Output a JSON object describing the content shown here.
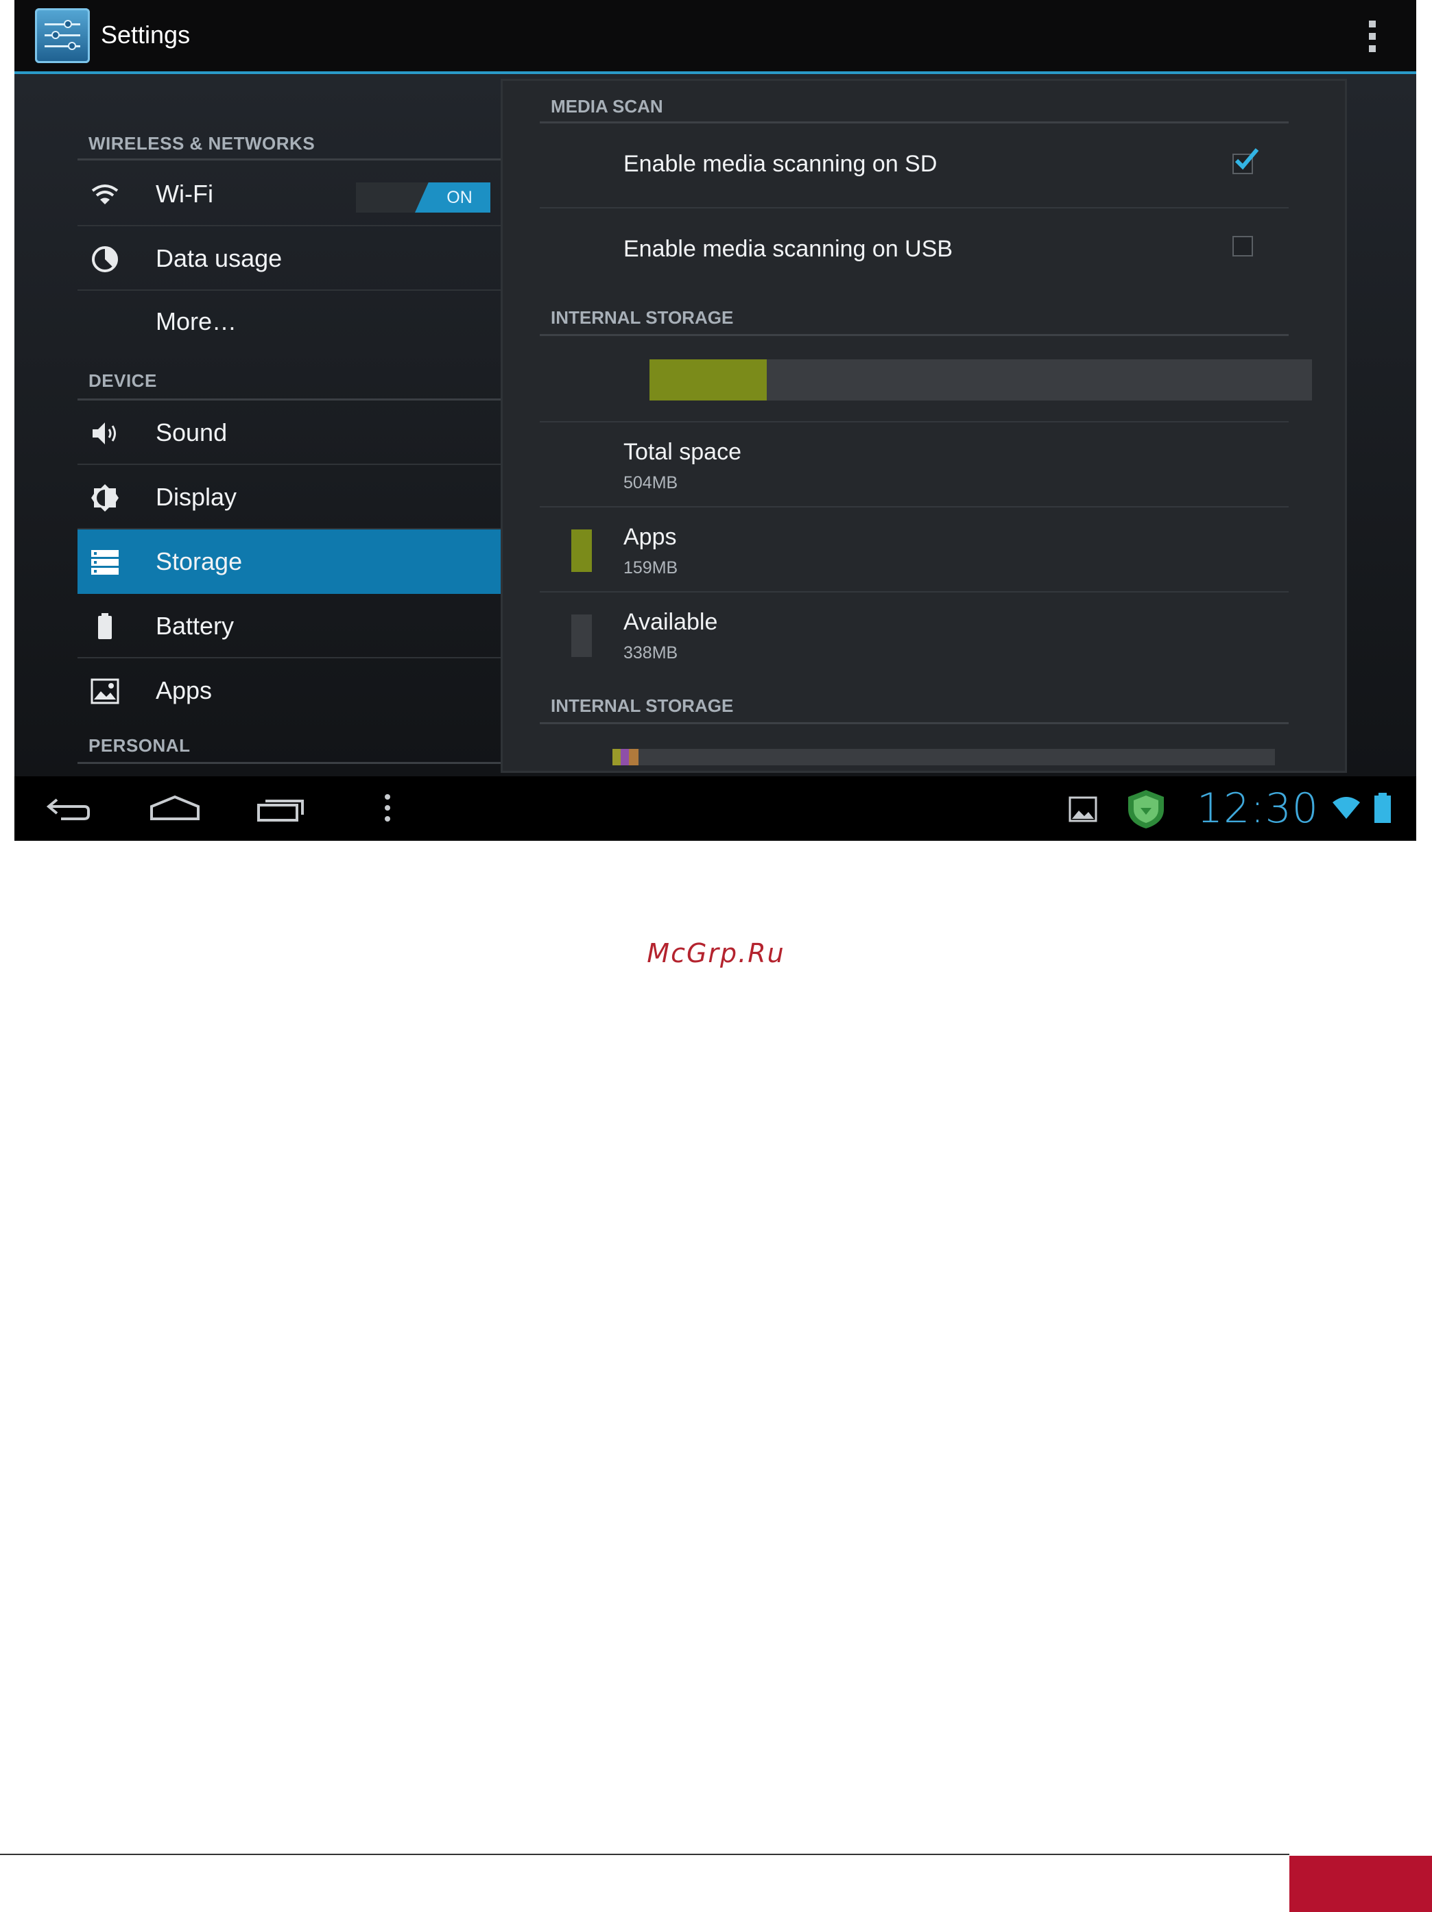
{
  "actionbar": {
    "title": "Settings",
    "icon": "settings-icon",
    "menu_icon": "overflow-menu-icon"
  },
  "sidebar": {
    "sections": [
      {
        "label": "WIRELESS & NETWORKS"
      },
      {
        "label": "DEVICE"
      },
      {
        "label": "PERSONAL"
      }
    ],
    "items": [
      {
        "label": "Wi-Fi",
        "icon": "wifi-icon",
        "toggle": "ON"
      },
      {
        "label": "Data usage",
        "icon": "data-usage-icon"
      },
      {
        "label": "More…",
        "icon": ""
      },
      {
        "label": "Sound",
        "icon": "speaker-icon"
      },
      {
        "label": "Display",
        "icon": "brightness-icon"
      },
      {
        "label": "Storage",
        "icon": "storage-icon",
        "selected": true
      },
      {
        "label": "Battery",
        "icon": "battery-icon"
      },
      {
        "label": "Apps",
        "icon": "apps-icon"
      }
    ]
  },
  "storage": {
    "media_scan": {
      "header": "MEDIA SCAN",
      "sd_label": "Enable media scanning on SD",
      "sd_checked": true,
      "usb_label": "Enable media scanning on USB",
      "usb_checked": false
    },
    "internal": {
      "header": "INTERNAL STORAGE",
      "used_fraction": 0.177,
      "total_label": "Total space",
      "total_value": "504MB",
      "apps_label": "Apps",
      "apps_value": "159MB",
      "available_label": "Available",
      "available_value": "338MB",
      "apps_color": "#7b8b1a",
      "available_color": "#3a3d41"
    },
    "internal2": {
      "header": "INTERNAL STORAGE"
    }
  },
  "statusbar": {
    "clock": "12:30",
    "icons": [
      "gallery-notification-icon",
      "shield-app-icon",
      "wifi-signal-icon",
      "battery-status-icon"
    ]
  },
  "navbar": {
    "icons": [
      "back-icon",
      "home-icon",
      "recent-apps-icon",
      "menu-dots-icon"
    ]
  },
  "document": {
    "watermark": "McGrp.Ru",
    "accent_color": "#b5122e"
  },
  "colors": {
    "holo_blue": "#0f79ad",
    "accent_line": "#2a9ac8"
  }
}
